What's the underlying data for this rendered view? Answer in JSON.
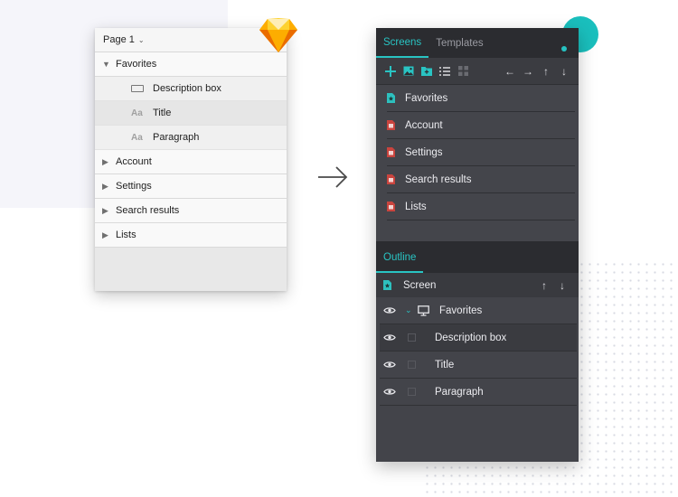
{
  "sketch_panel": {
    "page_selector": "Page 1",
    "favorites": "Favorites",
    "children": [
      {
        "icon": "rectangle-icon",
        "label": "Description box"
      },
      {
        "icon": "text-icon",
        "icon_text": "Aa",
        "label": "Title"
      },
      {
        "icon": "text-icon",
        "icon_text": "Aa",
        "label": "Paragraph"
      }
    ],
    "groups": [
      "Account",
      "Settings",
      "Search results",
      "Lists"
    ]
  },
  "plugin_panel": {
    "tabs": [
      "Screens",
      "Templates"
    ],
    "screens": [
      "Favorites",
      "Account",
      "Settings",
      "Search results",
      "Lists"
    ],
    "outline_tab": "Outline",
    "outline_header": "Screen",
    "outline_group": "Favorites",
    "outline_children": [
      "Description box",
      "Title",
      "Paragraph"
    ]
  },
  "colors": {
    "accent": "#29c4c3",
    "panel_bg": "#43444a",
    "tab_bg": "#2b2c30",
    "favorite_icon": "#2dc0be",
    "screen_icon": "#c9443e"
  }
}
